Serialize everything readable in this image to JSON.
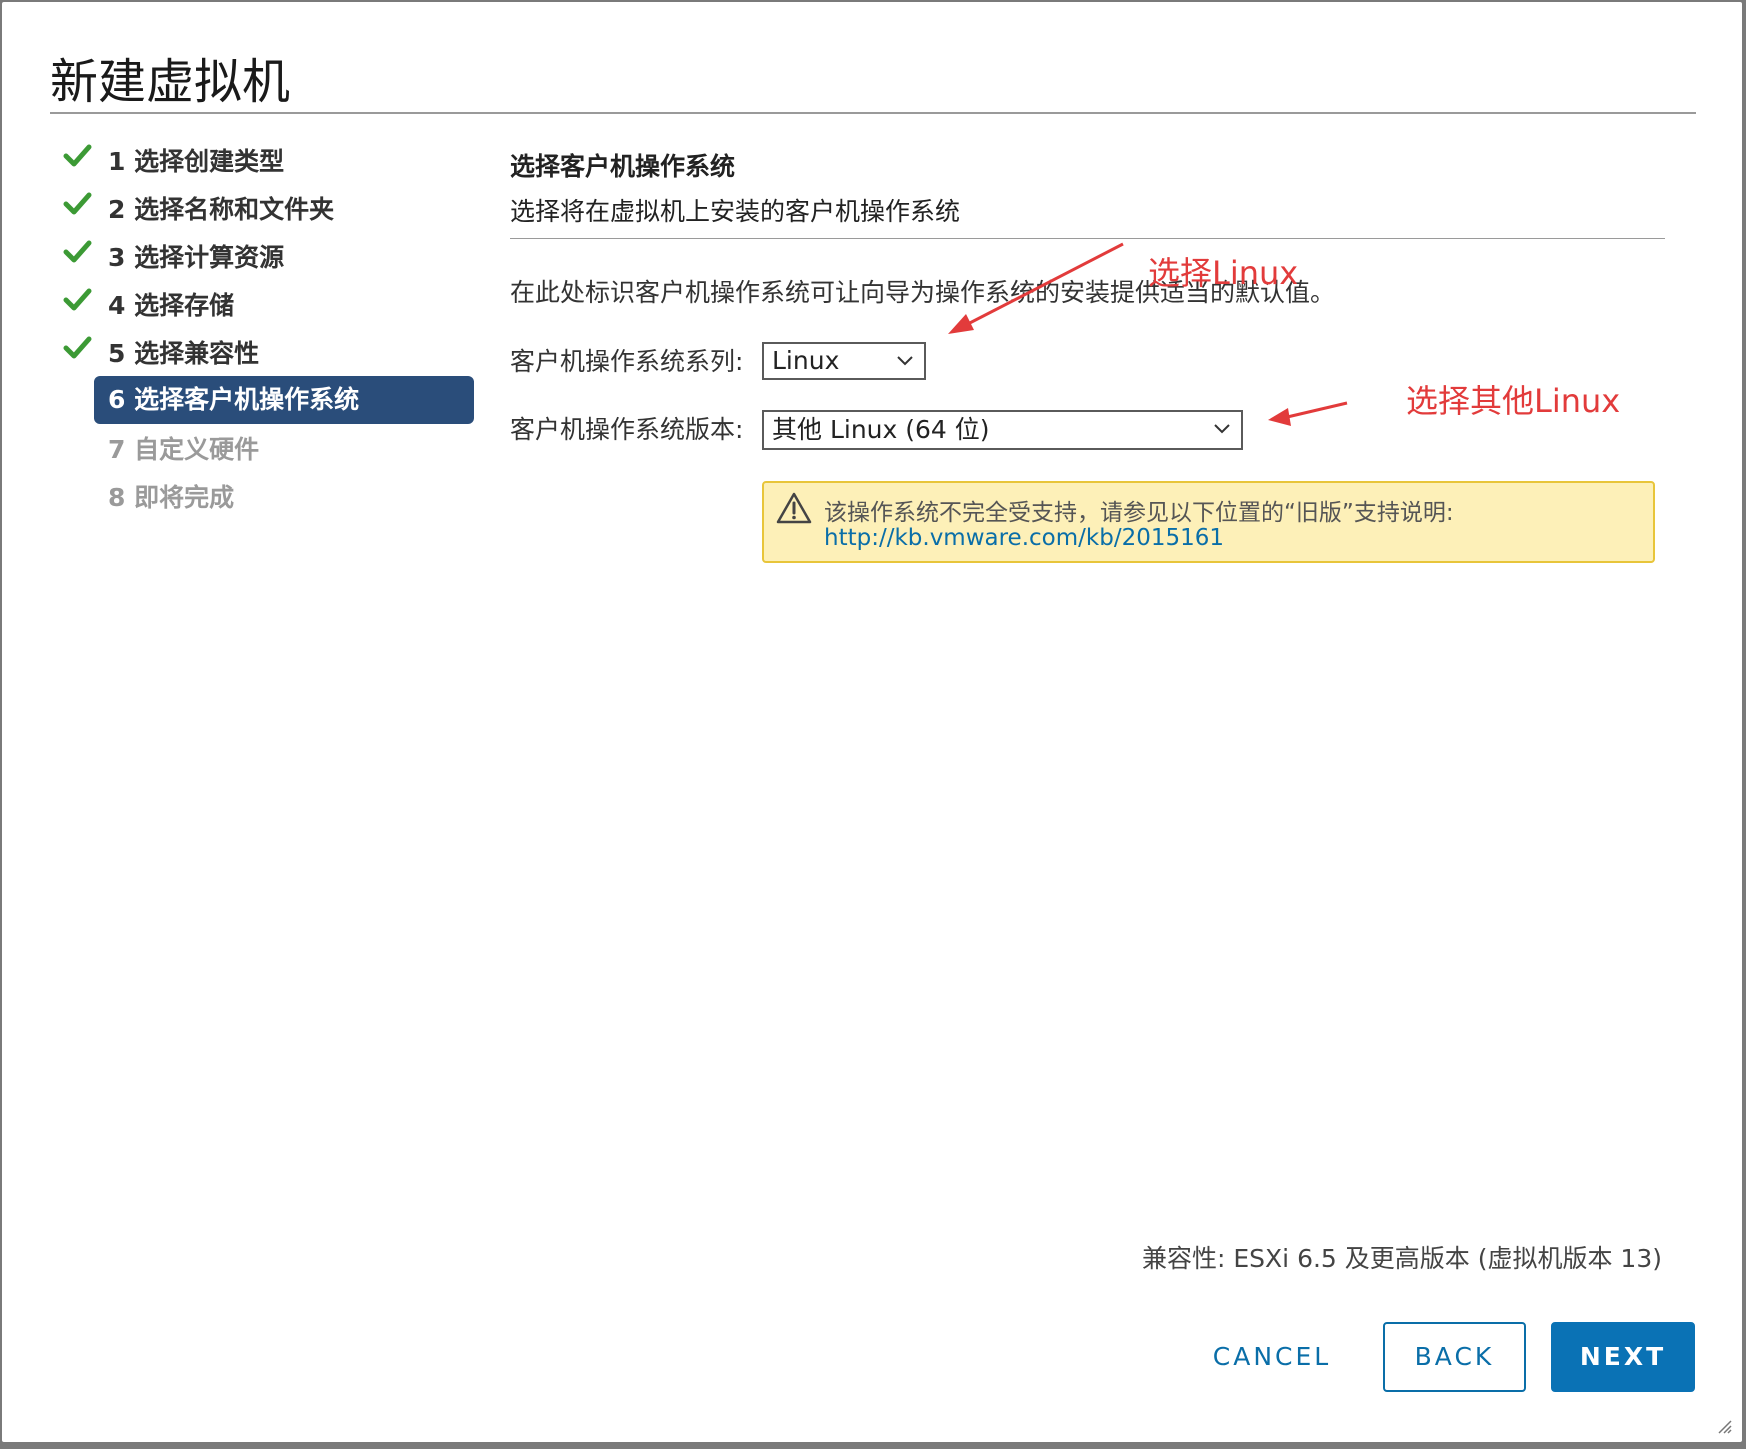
{
  "window": {
    "title": "新建虚拟机"
  },
  "steps": [
    {
      "label": "1 选择创建类型",
      "state": "done"
    },
    {
      "label": "2 选择名称和文件夹",
      "state": "done"
    },
    {
      "label": "3 选择计算资源",
      "state": "done"
    },
    {
      "label": "4 选择存储",
      "state": "done"
    },
    {
      "label": "5 选择兼容性",
      "state": "done"
    },
    {
      "label": "6 选择客户机操作系统",
      "state": "active"
    },
    {
      "label": "7 自定义硬件",
      "state": "todo"
    },
    {
      "label": "8 即将完成",
      "state": "todo"
    }
  ],
  "main": {
    "heading": "选择客户机操作系统",
    "subheading": "选择将在虚拟机上安装的客户机操作系统",
    "description": "在此处标识客户机操作系统可让向导为操作系统的安装提供适当的默认值。",
    "os_family": {
      "label": "客户机操作系统系列:",
      "value": "Linux"
    },
    "os_version": {
      "label": "客户机操作系统版本:",
      "value": "其他 Linux (64 位)"
    },
    "warning": {
      "text": "该操作系统不完全受支持，请参见以下位置的“旧版”支持说明:",
      "link": "http://kb.vmware.com/kb/2015161"
    },
    "compatibility": "兼容性: ESXi 6.5 及更高版本 (虚拟机版本 13)"
  },
  "buttons": {
    "cancel": "CANCEL",
    "back": "BACK",
    "next": "NEXT"
  },
  "annotations": {
    "family_note": "选择Linux",
    "version_note": "选择其他Linux"
  },
  "colors": {
    "active_step": "#2a4d7a",
    "check": "#3c9a35",
    "primary": "#0a72b5",
    "link": "#0a6ea8",
    "warning_bg": "#fdf0b8",
    "warning_border": "#e8c53a",
    "annotation": "#e23b3b"
  },
  "icons": {
    "step_done": "check-icon",
    "warning": "warning-triangle-icon",
    "select": "chevron-down-icon"
  }
}
